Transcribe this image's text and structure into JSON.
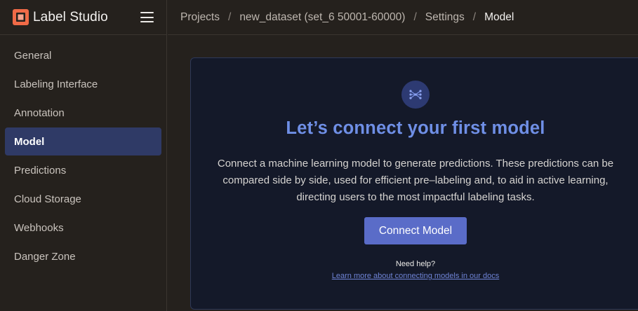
{
  "app": {
    "name": "Label Studio"
  },
  "breadcrumb": [
    {
      "label": "Projects"
    },
    {
      "label": "new_dataset (set_6 50001-60000)"
    },
    {
      "label": "Settings"
    },
    {
      "label": "Model"
    }
  ],
  "breadcrumb_separator": "/",
  "sidebar": {
    "items": [
      {
        "label": "General",
        "active": false
      },
      {
        "label": "Labeling Interface",
        "active": false
      },
      {
        "label": "Annotation",
        "active": false
      },
      {
        "label": "Model",
        "active": true
      },
      {
        "label": "Predictions",
        "active": false
      },
      {
        "label": "Cloud Storage",
        "active": false
      },
      {
        "label": "Webhooks",
        "active": false
      },
      {
        "label": "Danger Zone",
        "active": false
      }
    ]
  },
  "main": {
    "title": "Let’s connect your first model",
    "description": "Connect a machine learning model to generate predictions. These predictions can be compared side by side, used for efficient pre‒labeling and, to aid in active learning, directing users to the most impactful labeling tasks.",
    "connect_button": "Connect Model",
    "help_text": "Need help?",
    "docs_link": "Learn more about connecting models in our docs"
  },
  "icons": {
    "logo": "label-studio-logo-icon",
    "menu": "hamburger-menu-icon",
    "model": "neural-network-icon"
  },
  "colors": {
    "accent": "#6f8fe6",
    "button": "#5a6cc8",
    "active_nav": "#2f3a66",
    "logo": "#f06a47"
  }
}
